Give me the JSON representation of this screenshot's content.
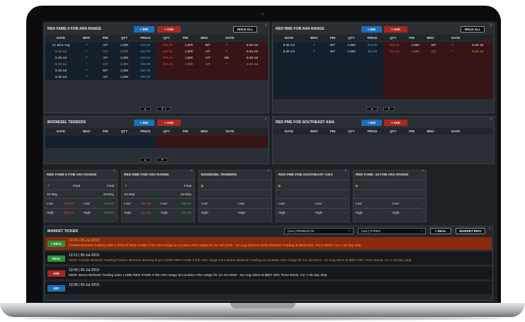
{
  "colors": {
    "bid": "#1d6fb8",
    "ask": "#a92824",
    "positive": "#3fb54a",
    "negative": "#e0483f",
    "accent": "#e88a2a"
  },
  "buttons": {
    "bid": "+ BID",
    "ask": "+ ASK",
    "hold_all": "HOLD ALL",
    "new_deal": "+ DEAL",
    "market_info": "MARKET INFO"
  },
  "columns": [
    "DATE",
    "BRO",
    "PRI",
    "QTY",
    "PRICE",
    "QTY",
    "PRI",
    "BRO",
    "DATE"
  ],
  "p1": {
    "title": "RED FAME 0 FOB ARA RANGE",
    "rows": [
      {
        "bd": "12 Jul-2 Aug",
        "bb": "*",
        "bp": "AIT",
        "bq": "1,000",
        "bpx": "814.00",
        "apx": "809.00",
        "aq": "1,000",
        "ap": "BIT",
        "ab": "*",
        "ad": "5-26 Jul",
        "bc": "white",
        "ac": "white"
      },
      {
        "bd": "5-26 Jul",
        "bb": "*",
        "bp": "CIT",
        "bq": "1,000",
        "bpx": "813.00",
        "apx": "809.00",
        "aq": "1,000",
        "ap": "AIT",
        "ab": "*",
        "ad": "5-26 Jul",
        "bc": "orange",
        "ac": "white"
      },
      {
        "bd": "5-26 Jul",
        "bb": "*",
        "bp": "AIT",
        "bq": "1,000",
        "bpx": "810.00",
        "apx": "809.00",
        "aq": "1,000",
        "ap": "AIT",
        "ab": "ZBI",
        "ad": "5-26 Jul",
        "bc": "white",
        "ac": "white"
      },
      {
        "bd": "5-26 Jul",
        "bb": "*",
        "bp": "CIT",
        "bq": "1,000",
        "bpx": "803.00",
        "apx": "814.00",
        "aq": "1,000",
        "ap": "CIT",
        "ab": "*",
        "ad": "5-26 Jul",
        "bc": "orange",
        "ac": "orange"
      },
      {
        "bd": "5-26 Jul",
        "bb": "*",
        "bp": "BIT",
        "bq": "1,000",
        "bpx": "800.00",
        "apx": "",
        "aq": "",
        "ap": "",
        "ab": "",
        "ad": "",
        "bc": "white",
        "ac": "white"
      },
      {
        "bd": "5-26 Jul",
        "bb": "*",
        "bp": "AIT",
        "bq": "1,000",
        "bpx": "800.00",
        "apx": "",
        "aq": "",
        "ap": "",
        "ab": "",
        "ad": "",
        "bc": "white",
        "ac": "white"
      }
    ],
    "pager": "2"
  },
  "p2": {
    "title": "RED RME FOB ARA RANGE",
    "rows": [
      {
        "bd": "5-26 Jul",
        "bb": "*",
        "bp": "BIT",
        "bq": "1,000",
        "bpx": "915.00",
        "apx": "906.00",
        "aq": "1,000",
        "ap": "BIT",
        "ab": "*",
        "ad": "5-26 Jul",
        "bc": "white",
        "ac": "white"
      },
      {
        "bd": "5-26 Jul",
        "bb": "*",
        "bp": "BIT",
        "bq": "1,000",
        "bpx": "911.00",
        "apx": "913.00",
        "aq": "1,000",
        "ap": "CIT",
        "ab": "*",
        "ad": "5-26 Jul",
        "bc": "white",
        "ac": "orange"
      }
    ]
  },
  "p3": {
    "title": "BIODIESEL TENDERS"
  },
  "p4": {
    "title": "RED PME FOB SOUTHEAST ASIA"
  },
  "cards": [
    {
      "title": "RED FAME 0 FOB ARA RANGE",
      "dir": "▼",
      "dircolor": "#e0483f",
      "f1": "Final",
      "f2": "Final",
      "d1": "16-May",
      "d2": "15-May",
      "low1": "799.00",
      "low2": "810.00",
      "high1": "805.00",
      "high2": "820.00",
      "lc1": "#e0483f",
      "lc2": "#3fb54a",
      "hc1": "#e0483f",
      "hc2": "#3fb54a"
    },
    {
      "title": "RED RME FOB ARA RANGE",
      "dir": "▼",
      "dircolor": "#e0483f",
      "f1": "",
      "f2": "Final",
      "d1": "16-May",
      "d2": "15-May",
      "low1": "864.00",
      "low2": "865.00",
      "high1": "814.00",
      "high2": "815.00",
      "lc1": "#e0483f",
      "lc2": "#3fb54a",
      "hc1": "#e0483f",
      "hc2": "#3fb54a"
    },
    {
      "title": "BIODIESEL TENDERS",
      "dir": "▶",
      "dircolor": "#e88a2a",
      "f1": "",
      "f2": "",
      "d1": "",
      "d2": "",
      "low1": "-",
      "low2": "-",
      "high1": "-",
      "high2": "-",
      "lc1": "#dfe2e6",
      "lc2": "#dfe2e6",
      "hc1": "#dfe2e6",
      "hc2": "#dfe2e6"
    },
    {
      "title": "RED PME FOB SOUTHEAST ASIA",
      "dir": "▶",
      "dircolor": "#e88a2a",
      "f1": "",
      "f2": "",
      "d1": "",
      "d2": "",
      "low1": "-",
      "low2": "-",
      "high1": "-",
      "high2": "-",
      "lc1": "#dfe2e6",
      "lc2": "#dfe2e6",
      "hc1": "#dfe2e6",
      "hc2": "#dfe2e6"
    },
    {
      "title": "RED FAME -10 FOB ARA RANGE",
      "dir": "▶",
      "dircolor": "#e88a2a",
      "f1": "",
      "f2": "",
      "d1": "",
      "d2": "",
      "low1": "-",
      "low2": "-",
      "high1": "-",
      "high2": "-",
      "lc1": "#dfe2e6",
      "lc2": "#dfe2e6",
      "hc1": "#dfe2e6",
      "hc2": "#dfe2e6"
    }
  ],
  "card_labels": {
    "low": "Low:",
    "high": "High:"
  },
  "ticker": {
    "title": "MARKET TICKER",
    "products": "(ALL) PRODUCTS",
    "types": "(ALL) TYPES",
    "items": [
      {
        "tag": "+ DEAL",
        "tagcolor": "#2f8f3a",
        "time": "13:24 | 05-Jul-2019",
        "text": "Charlie Biofuels Trading sells 1,000t of RED FAME 0 fob ARA range at Location ARA range for 12-Jul-2019 - 02-Aug-2019 to Delta Biofuels Trading at $810.00/t, Price Basis: Ice 7-28 day strip",
        "hl": true
      },
      {
        "tag": "DEAL",
        "tagcolor": "#2f8f3a",
        "time": "13:13 | 05-Jul-2019",
        "text": "NEW: Charlie Biofuels Trading/Yankee Biofuels Broking buys 1,000t RED FAME 0 fob ARA range from Bravo Biofuels Trading at Location ARA range for 12-Jul-2019 - 02-Aug-2019 at $807.00/t, Price Basis: Ice 7-28 day strip",
        "hl": false
      },
      {
        "tag": "ASK",
        "tagcolor": "#a92824",
        "time": "13:09 | 05-Jul-2019",
        "text": "NEW: Bravo Biofuels Trading asks 1,000t RED FAME 0 fob ARA range at Location ARA range for 12-Jul-2019 - 02-Aug-2019 at $807.00/t, Price Basis: Ice 7-28 day strip",
        "hl": false
      },
      {
        "tag": "BID",
        "tagcolor": "#1d6fb8",
        "time": "13:08 | 05-Jul-2019",
        "text": "",
        "hl": false
      }
    ]
  }
}
